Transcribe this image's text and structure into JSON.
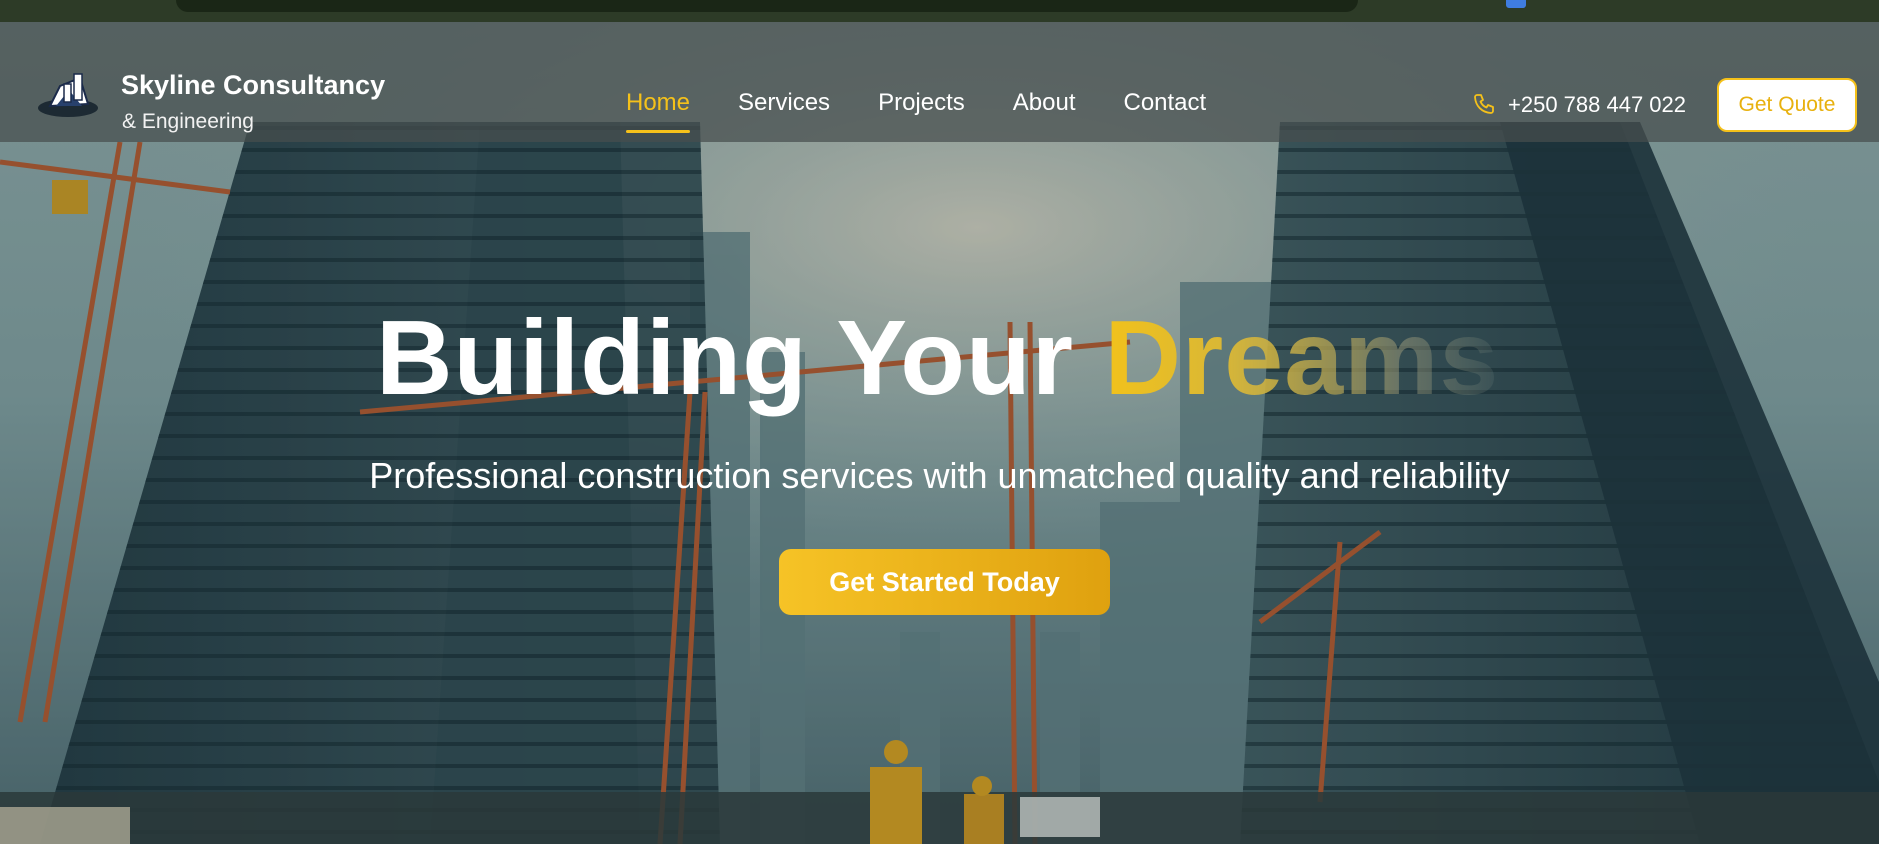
{
  "header": {
    "brand_name": "Skyline Consultancy",
    "brand_sub": "& Engineering",
    "nav": [
      {
        "label": "Home",
        "active": true
      },
      {
        "label": "Services",
        "active": false
      },
      {
        "label": "Projects",
        "active": false
      },
      {
        "label": "About",
        "active": false
      },
      {
        "label": "Contact",
        "active": false
      }
    ],
    "phone": "+250 788 447 022",
    "quote_label": "Get Quote"
  },
  "hero": {
    "headline_main": "Building Your ",
    "headline_accent": "Dreams",
    "subtitle": "Professional construction services with unmatched quality and reliability",
    "cta_label": "Get Started Today"
  },
  "colors": {
    "accent": "#f5c11a",
    "header_bg": "#464e4e",
    "text": "#ffffff"
  },
  "icons": {
    "logo": "building-logo-icon",
    "phone": "phone-icon"
  }
}
